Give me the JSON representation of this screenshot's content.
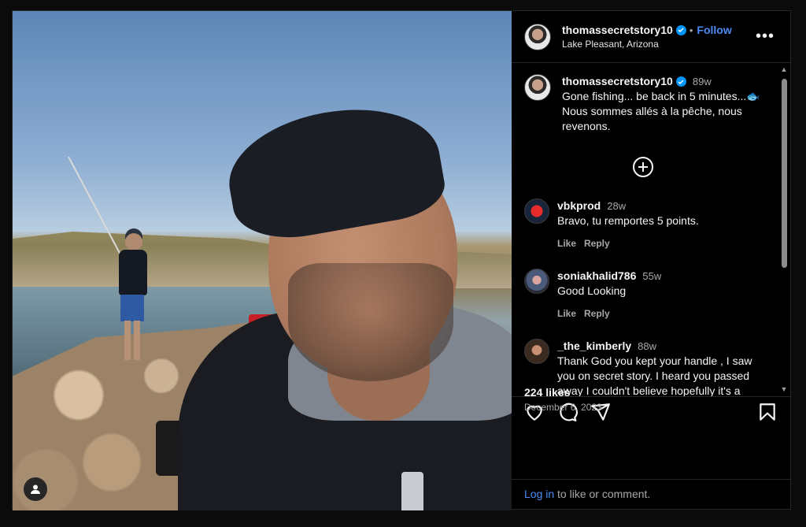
{
  "post": {
    "username": "thomassecretstory10",
    "follow_label": "Follow",
    "separator": "•",
    "location": "Lake Pleasant, Arizona",
    "more_icon": "more-horizontal-icon"
  },
  "caption": {
    "username": "thomassecretstory10",
    "time": "89w",
    "text": "Gone fishing... be back in 5 minutes...🐟 Nous sommes allés à la pêche, nous revenons."
  },
  "comments": [
    {
      "username": "vbkprod",
      "time": "28w",
      "text": "Bravo, tu remportes 5 points.",
      "like": "Like",
      "reply": "Reply"
    },
    {
      "username": "soniakhalid786",
      "time": "55w",
      "text": "Good Looking",
      "like": "Like",
      "reply": "Reply"
    },
    {
      "username": "_the_kimberly",
      "time": "88w",
      "text": "Thank God you kept your handle , I saw you on secret story. I heard you passed away I couldn't believe hopefully it's a"
    }
  ],
  "stats": {
    "likes": "224 likes",
    "date": "December 6, 2023"
  },
  "login": {
    "link": "Log in",
    "rest": " to like or comment."
  },
  "colors": {
    "background": "#000000",
    "accent": "#4c8bf5",
    "verified": "#0095f6",
    "muted": "#a8a8a8"
  }
}
